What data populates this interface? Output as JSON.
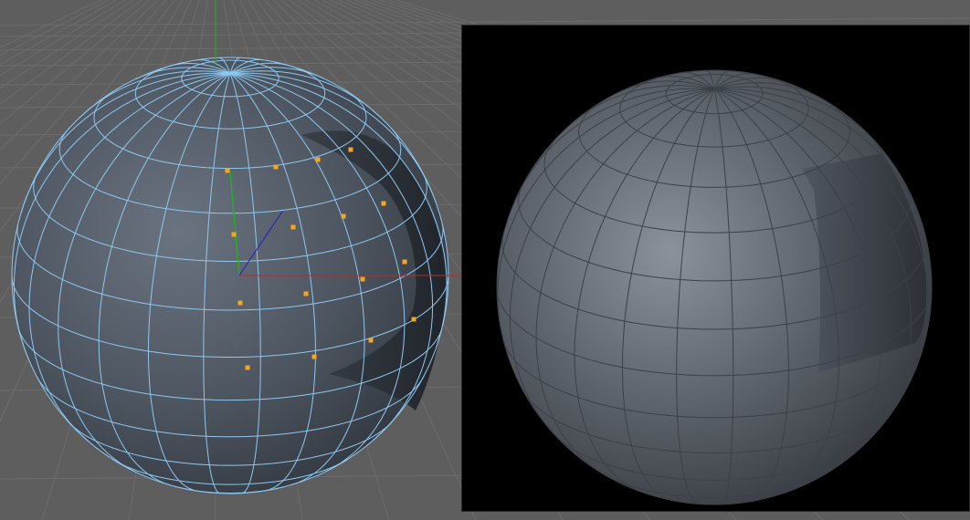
{
  "scene": {
    "viewport": {
      "name": "editor-viewport",
      "background_color": "#5e5e5e",
      "grid_line_color": "#6c6c6c",
      "wire_color": "#8ec8f0",
      "point_color": "#f5a623",
      "axis_x_color": "#d02020",
      "axis_y_color": "#20b020",
      "axis_z_color": "#2020c0"
    },
    "render": {
      "name": "render-preview",
      "background_color": "#000000",
      "sphere_color": "#7a8088"
    }
  }
}
